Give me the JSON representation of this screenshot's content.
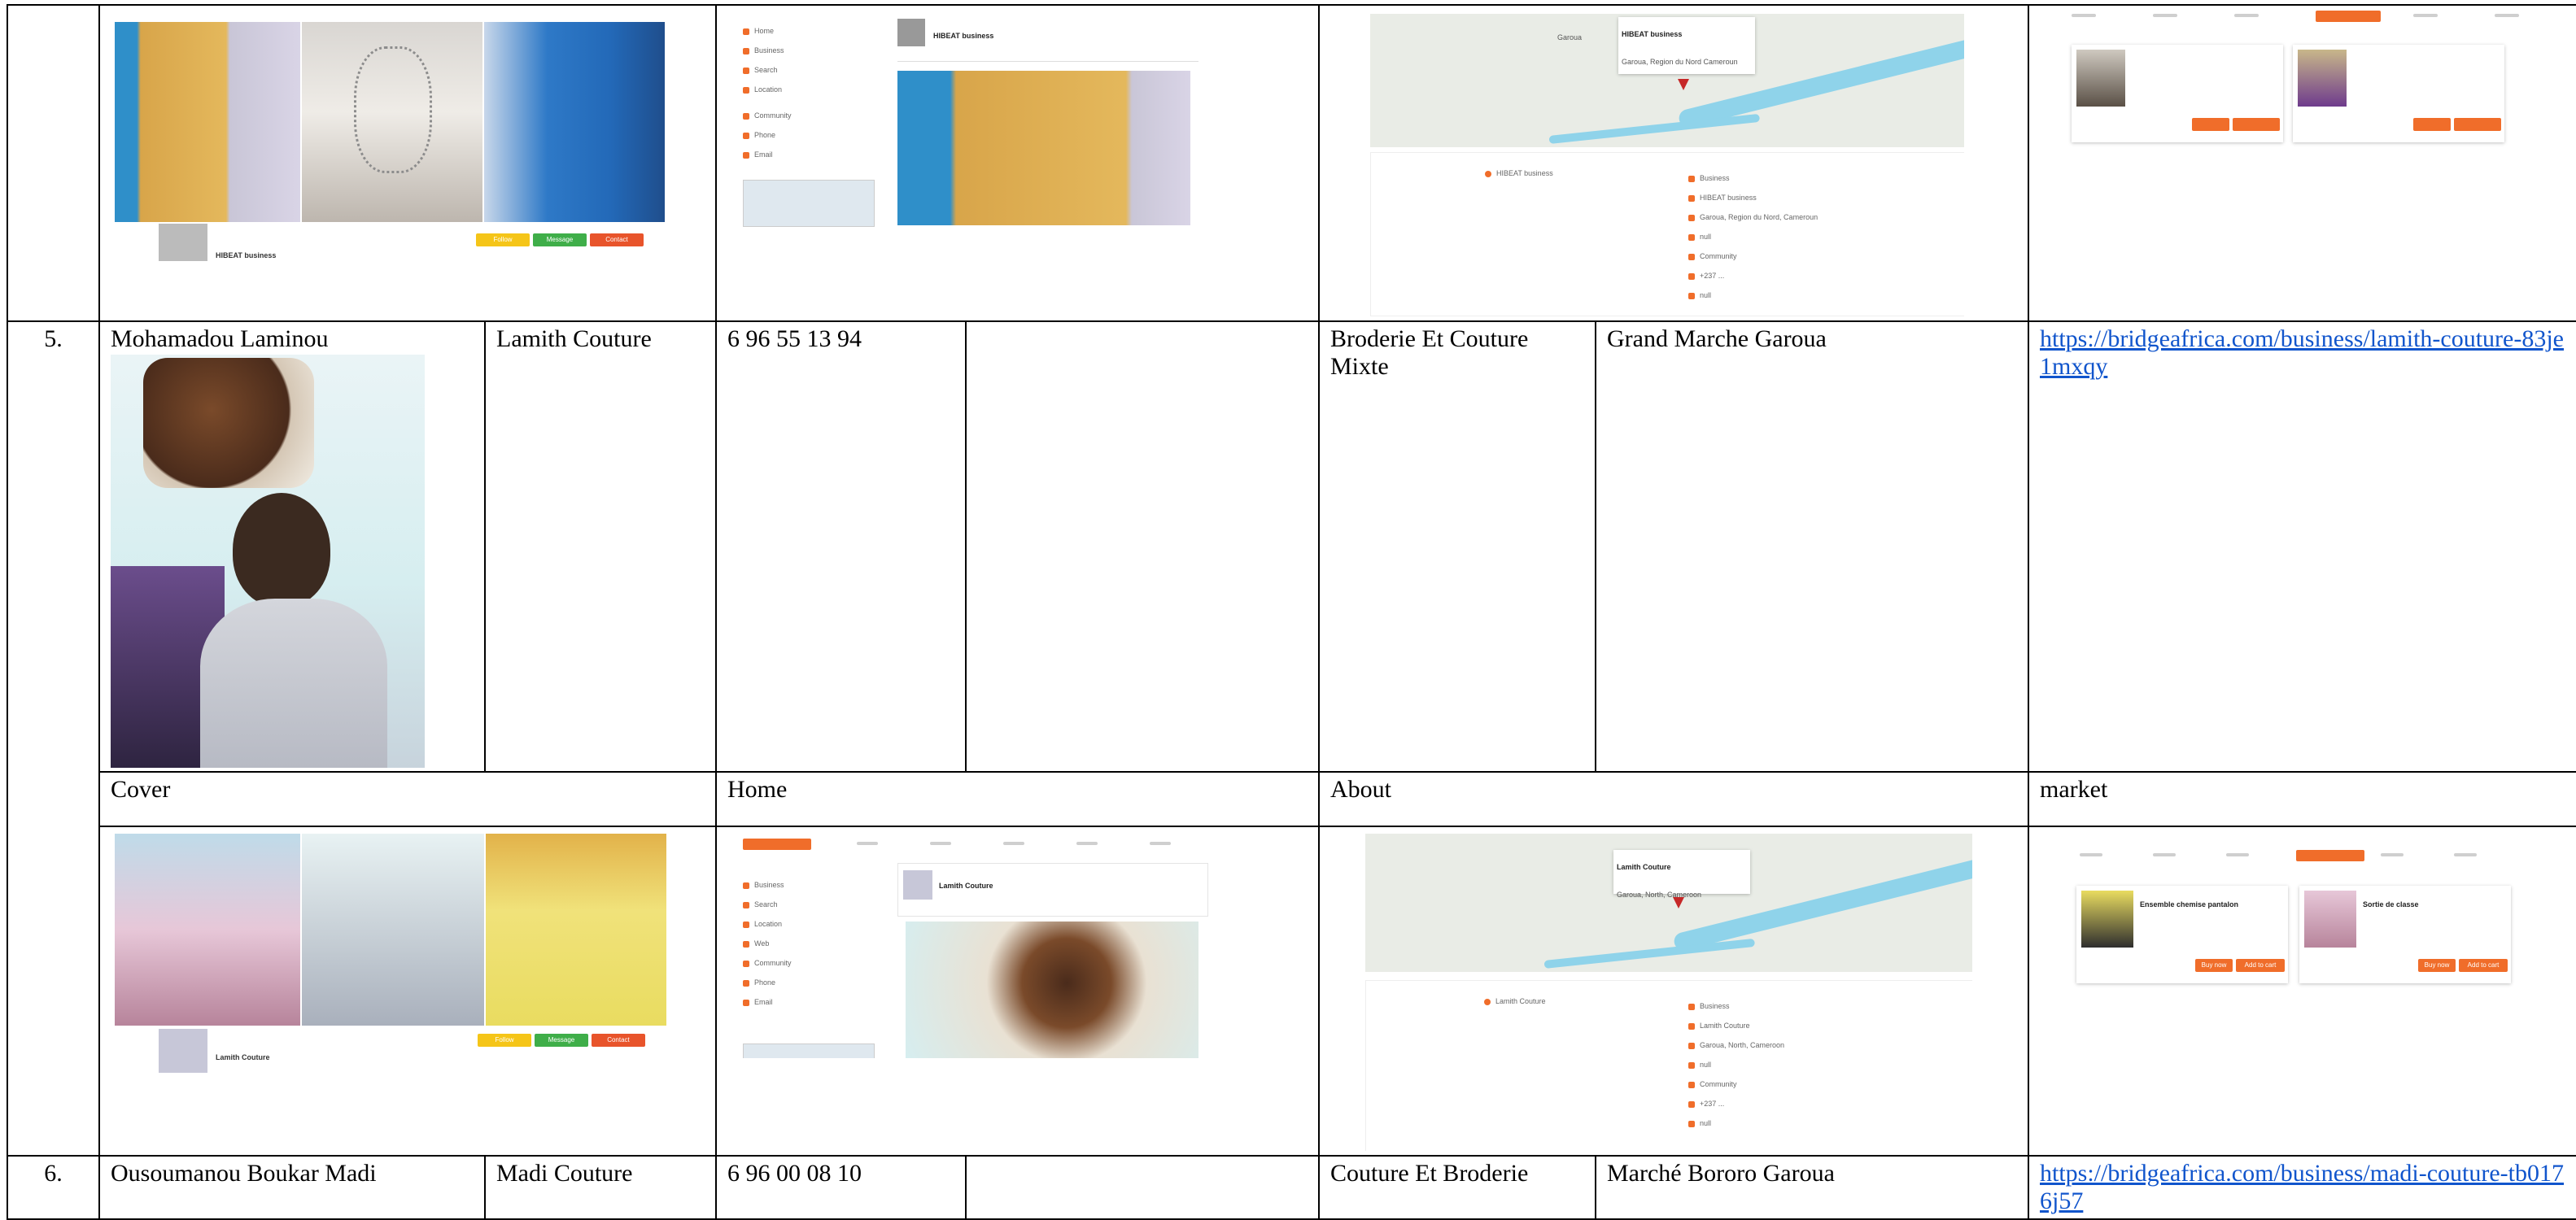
{
  "top_row": {
    "cover": {
      "business_name": "HIBEAT business",
      "buttons": [
        "Follow",
        "Message",
        "Contact"
      ]
    },
    "home": {
      "business_name": "HIBEAT business"
    },
    "about": {
      "map_title": "HIBEAT business",
      "map_subtitle": "Garoua, Region du Nord Cameroun",
      "map_town": "Garoua",
      "business_name": "HIBEAT business",
      "items": [
        "Business",
        "HIBEAT business",
        "Garoua, Region du Nord, Cameroun",
        "null",
        "Community",
        "+237 ...",
        "null"
      ]
    }
  },
  "row5": {
    "number": "5.",
    "name": "Mohamadou Laminou",
    "business": "Lamith Couture",
    "phone": "6 96 55 13 94",
    "category": "Broderie Et Couture Mixte",
    "location": "Grand Marche Garoua",
    "link": "https://bridgeafrica.com/business/lamith-couture-83je1mxqy",
    "section_labels": {
      "cover": "Cover",
      "home": "Home",
      "about": "About",
      "market": "market"
    },
    "cover": {
      "business_name": "Lamith Couture",
      "buttons": [
        "Follow",
        "Message",
        "Contact"
      ]
    },
    "home": {
      "business_name": "Lamith Couture"
    },
    "about": {
      "map_title": "Lamith Couture",
      "map_subtitle": "Garoua, North, Cameroon",
      "business_name": "Lamith Couture",
      "items": [
        "Business",
        "Lamith Couture",
        "Garoua, North, Cameroon",
        "null",
        "Community",
        "+237 ...",
        "null"
      ]
    },
    "market": {
      "products": [
        "Ensemble chemise pantalon",
        "Sortie de classe"
      ],
      "buttons": [
        "Buy now",
        "Add to cart"
      ]
    }
  },
  "row6": {
    "number": "6.",
    "name": "Ousoumanou Boukar Madi",
    "business": "Madi Couture",
    "phone": "6 96 00 08 10",
    "category": "Couture Et Broderie",
    "location": "Marché Bororo Garoua",
    "link": "https://bridgeafrica.com/business/madi-couture-tb0176j57"
  },
  "colors": {
    "link": "#1155cc",
    "accent": "#f06d2a",
    "follow": "#f5c518",
    "message": "#3fae49",
    "contact": "#e8542b",
    "river": "#8fd3ea"
  }
}
